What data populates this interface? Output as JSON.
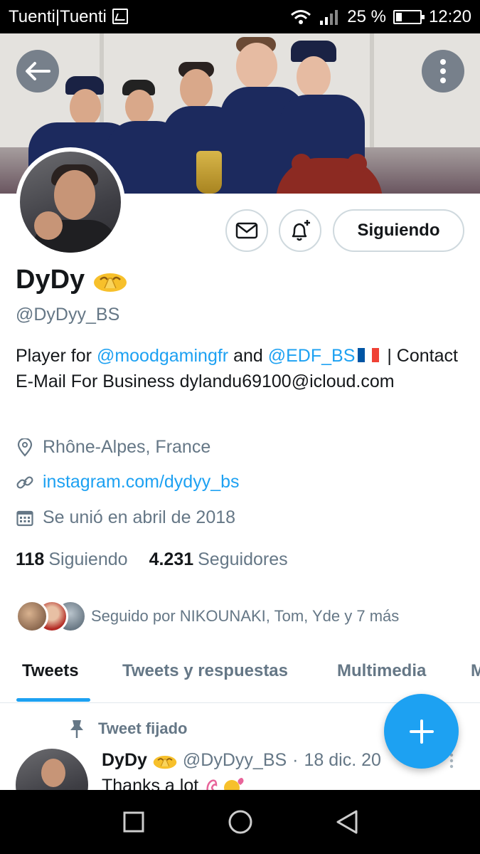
{
  "status_bar": {
    "carrier": "Tuenti|Tuenti",
    "battery": "25 %",
    "battery_level": 0.25,
    "time": "12:20"
  },
  "header": {
    "back_icon": "arrow-left-icon",
    "more_icon": "more-vertical-icon"
  },
  "profile": {
    "name": "DyDy",
    "name_emoji": "pray-emoji",
    "handle": "@DyDyy_BS",
    "bio": {
      "part1": "Player for ",
      "mention1": "@moodgamingfr",
      "part2": " and ",
      "mention2": "@EDF_BS",
      "part3": " | Contact E-Mail For Business dylandu69100@icloud.com"
    },
    "location": "Rhône-Alpes, France",
    "website": "instagram.com/dydyy_bs",
    "joined": "Se unió en abril de 2018",
    "following_count": "118",
    "following_label": "Siguiendo",
    "followers_count": "4.231",
    "followers_label": "Seguidores",
    "followed_by": "Seguido por NIKOUNAKI, Tom, Yde y 7 más"
  },
  "actions": {
    "follow_label": "Siguiendo",
    "message_icon": "mail-icon",
    "notify_icon": "bell-plus-icon"
  },
  "tabs": [
    {
      "label": "Tweets",
      "active": true
    },
    {
      "label": "Tweets y respuestas",
      "active": false
    },
    {
      "label": "Multimedia",
      "active": false
    },
    {
      "label": "M",
      "active": false
    }
  ],
  "tweet": {
    "pinned_label": "Tweet fijado",
    "author_name": "DyDy",
    "author_handle": "@DyDyy_BS",
    "separator": "·",
    "date": "18 dic. 20",
    "text": "Thanks a lot"
  },
  "fab": {
    "icon": "plus-icon"
  },
  "nav_bar": {
    "recent_icon": "square-icon",
    "home_icon": "circle-icon",
    "back_icon": "triangle-back-icon"
  },
  "colors": {
    "accent": "#1da1f2",
    "text_primary": "#14171a",
    "text_secondary": "#657786"
  }
}
